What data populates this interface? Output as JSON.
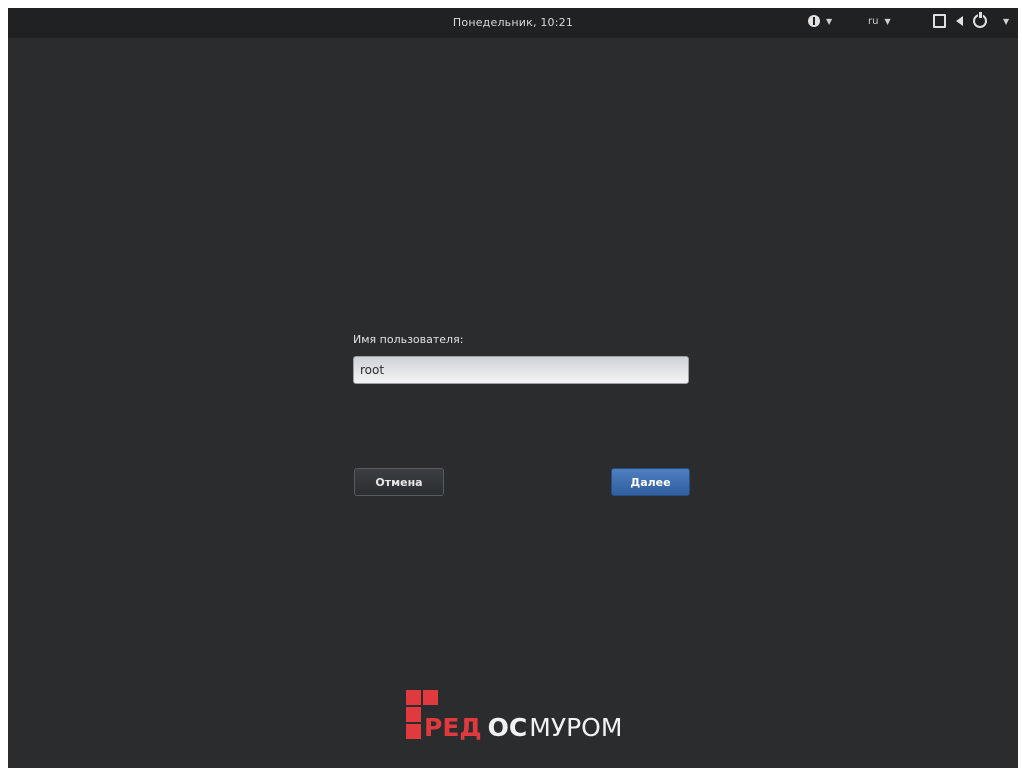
{
  "topbar": {
    "clock": "Понедельник, 10:21",
    "language": "ru",
    "icons": [
      "accessibility-icon",
      "display-icon",
      "volume-icon",
      "power-icon"
    ]
  },
  "login": {
    "prompt_label": "Имя пользователя:",
    "username_value": "root",
    "cancel_label": "Отмена",
    "next_label": "Далее"
  },
  "branding": {
    "logo_red": "РЕД",
    "logo_os": "ОС",
    "logo_name": "МУРОМ",
    "accent_color": "#e03a3e"
  },
  "colors": {
    "background": "#2a2c2e",
    "topbar": "#1f2122",
    "primary_button": "#3a6aaa"
  }
}
